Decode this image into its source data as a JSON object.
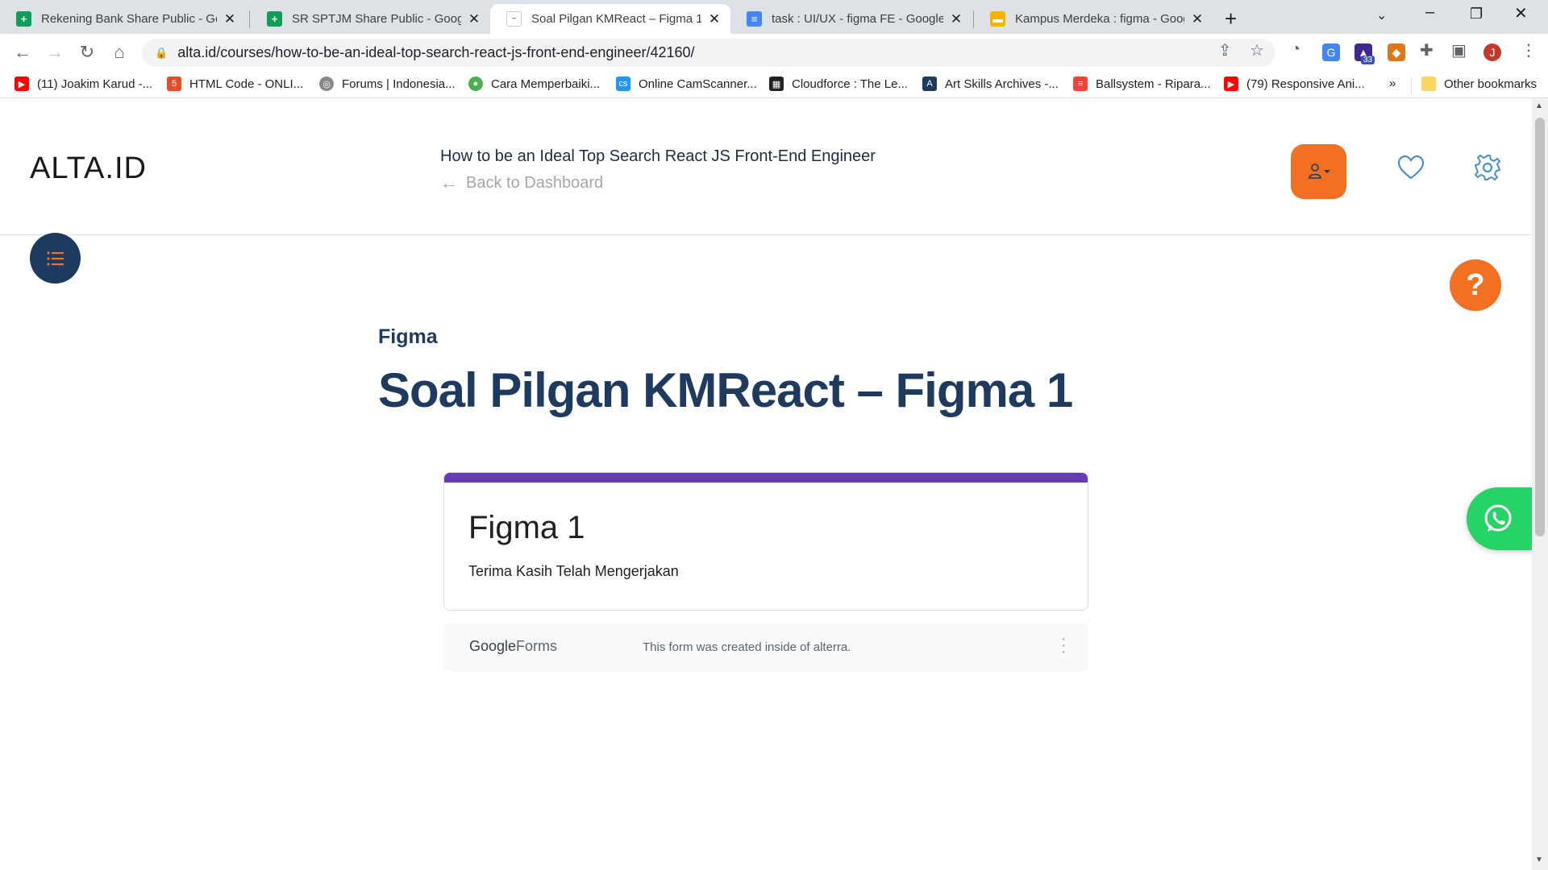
{
  "browser": {
    "tabs": [
      {
        "title": "Rekening Bank Share Public - Go",
        "icon": "google-sheets-icon",
        "color": "#0f9d58"
      },
      {
        "title": "SR SPTJM Share Public - Google S",
        "icon": "google-sheets-icon",
        "color": "#0f9d58"
      },
      {
        "title": "Soal Pilgan KMReact – Figma 1",
        "icon": "page-icon",
        "color": "#ffffff",
        "active": true
      },
      {
        "title": "task : UI/UX - figma FE - Google D",
        "icon": "google-docs-icon",
        "color": "#4285f4"
      },
      {
        "title": "Kampus Merdeka : figma - Googl",
        "icon": "google-slides-icon",
        "color": "#f4b400"
      }
    ],
    "url": "alta.id/courses/how-to-be-an-ideal-top-search-react-js-front-end-engineer/42160/",
    "extension_badge": "33",
    "bookmarks": [
      {
        "label": "(11) Joakim Karud -...",
        "icon": "youtube-icon",
        "color": "#ff0000"
      },
      {
        "label": "HTML Code - ONLI...",
        "icon": "html-icon",
        "color": "#e44d26"
      },
      {
        "label": "Forums | Indonesia...",
        "icon": "globe-icon",
        "color": "#888888"
      },
      {
        "label": "Cara Memperbaiki...",
        "icon": "site-icon",
        "color": "#4caf50"
      },
      {
        "label": "Online CamScanner...",
        "icon": "camscanner-icon",
        "color": "#2196f3"
      },
      {
        "label": "Cloudforce : The Le...",
        "icon": "cloudforce-icon",
        "color": "#222222"
      },
      {
        "label": "Art Skills Archives -...",
        "icon": "artskills-icon",
        "color": "#1e3a5f"
      },
      {
        "label": "Ballsystem - Ripara...",
        "icon": "ballsystem-icon",
        "color": "#f44336"
      },
      {
        "label": "(79) Responsive Ani...",
        "icon": "youtube-icon",
        "color": "#ff0000"
      }
    ],
    "bookmarks_overflow": "»",
    "other_bookmarks": "Other bookmarks"
  },
  "site": {
    "logo": "ALTA.ID",
    "course_title": "How to be an Ideal Top Search React JS Front-End Engineer",
    "back_label": "Back to Dashboard",
    "accent_color": "#f36f21",
    "primary_color": "#1e3a5f"
  },
  "lesson": {
    "section": "Figma",
    "title": "Soal Pilgan KMReact – Figma 1"
  },
  "form": {
    "title": "Figma 1",
    "message": "Terima Kasih Telah Mengerjakan",
    "accent_color": "#673ab7",
    "footer_brand_google": "Google",
    "footer_brand_forms": "Forms",
    "footer_note": "This form was created inside of alterra."
  },
  "help_symbol": "?"
}
